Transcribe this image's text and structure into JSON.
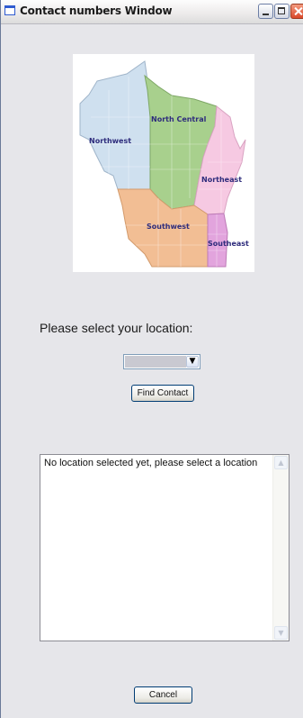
{
  "window": {
    "title": "Contact numbers Window",
    "controls": {
      "minimize_icon": "minimize-icon",
      "maximize_icon": "maximize-icon",
      "close_icon": "close-icon"
    }
  },
  "map": {
    "regions": [
      "Northwest",
      "North Central",
      "Northeast",
      "Southwest",
      "Southeast"
    ],
    "colors": {
      "Northwest": "#cfe0ef",
      "North Central": "#a8d08d",
      "Northeast": "#f6c9e2",
      "Southwest": "#f2be94",
      "Southeast": "#e2a4dd"
    }
  },
  "form": {
    "prompt": "Please select your location:",
    "location_select": {
      "value": ""
    },
    "find_button": "Find Contact"
  },
  "result": {
    "text": "No location selected yet, please select a location"
  },
  "footer": {
    "cancel_button": "Cancel"
  }
}
